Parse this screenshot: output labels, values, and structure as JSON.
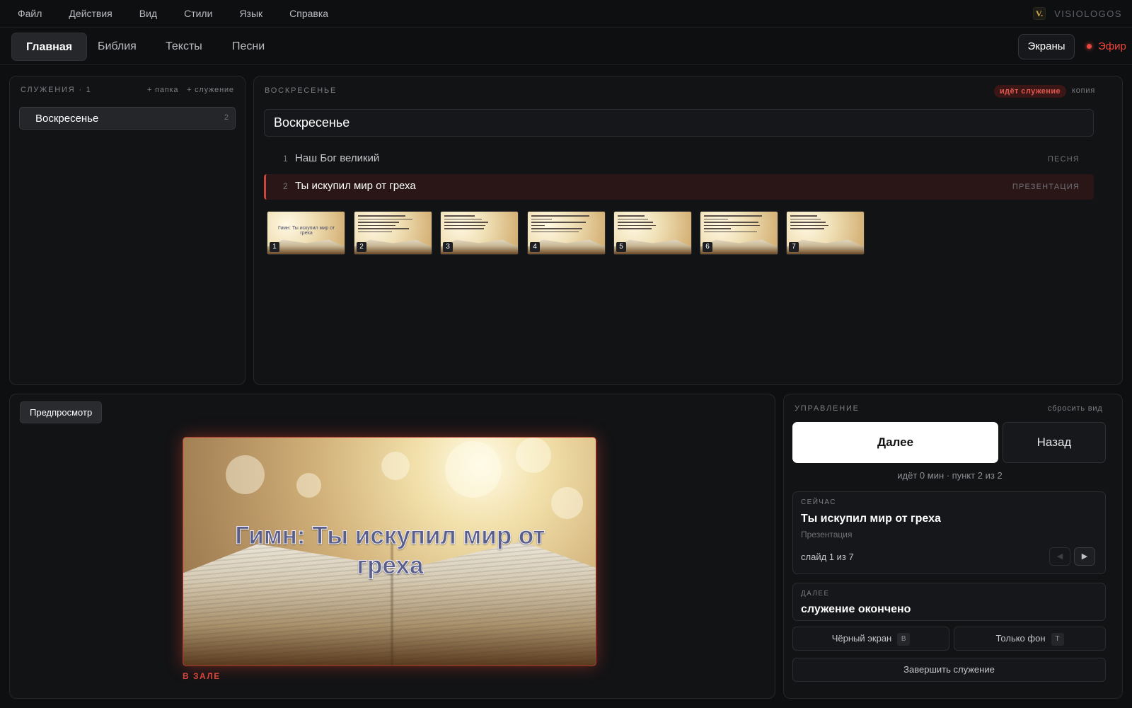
{
  "menu": {
    "items": [
      "Файл",
      "Действия",
      "Вид",
      "Стили",
      "Язык",
      "Справка"
    ],
    "brand_logo": "V.",
    "brand_name": "VISIOLOGOS"
  },
  "nav": {
    "tabs": [
      "Главная",
      "Библия",
      "Тексты",
      "Песни"
    ],
    "active_tab": "Главная",
    "screens_label": "Экраны",
    "onair_label": "Эфир"
  },
  "services": {
    "caption": "СЛУЖЕНИЯ · 1",
    "add_folder": "+ папка",
    "add_service": "+ служение",
    "items": [
      {
        "name": "Воскресенье",
        "count": "2"
      }
    ]
  },
  "service": {
    "caption": "ВОСКРЕСЕНЬЕ",
    "live_badge": "идёт служение",
    "copy_label": "копия",
    "title": "Воскресенье",
    "items": [
      {
        "num": "1",
        "name": "Наш Бог великий",
        "kind": "ПЕСНЯ"
      },
      {
        "num": "2",
        "name": "Ты искупил мир от греха",
        "kind": "ПРЕЗЕНТАЦИЯ"
      }
    ],
    "slides": [
      "1",
      "2",
      "3",
      "4",
      "5",
      "6",
      "7"
    ],
    "first_slide_title": "Гимн: Ты искупил мир от греха"
  },
  "preview": {
    "label": "Предпросмотр",
    "slide_title": "Гимн: Ты искупил мир от греха",
    "location": "В ЗАЛЕ"
  },
  "control": {
    "caption": "УПРАВЛЕНИЕ",
    "reset_view": "сбросить вид",
    "next_label": "Далее",
    "back_label": "Назад",
    "status": "идёт 0 мин · пункт 2 из 2",
    "now": {
      "caption": "СЕЙЧАС",
      "title": "Ты искупил мир от греха",
      "type": "Презентация",
      "slide": "слайд 1 из 7",
      "prev_icon": "◀",
      "next_icon": "▶"
    },
    "upcoming": {
      "caption": "ДАЛЕЕ",
      "title": "служение окончено"
    },
    "black_screen": {
      "label": "Чёрный экран",
      "key": "B"
    },
    "bg_only": {
      "label": "Только фон",
      "key": "T"
    },
    "end_label": "Завершить служение"
  },
  "colors": {
    "accent_red": "#e8473d",
    "background": "#0e0f11",
    "panel": "#121315"
  }
}
